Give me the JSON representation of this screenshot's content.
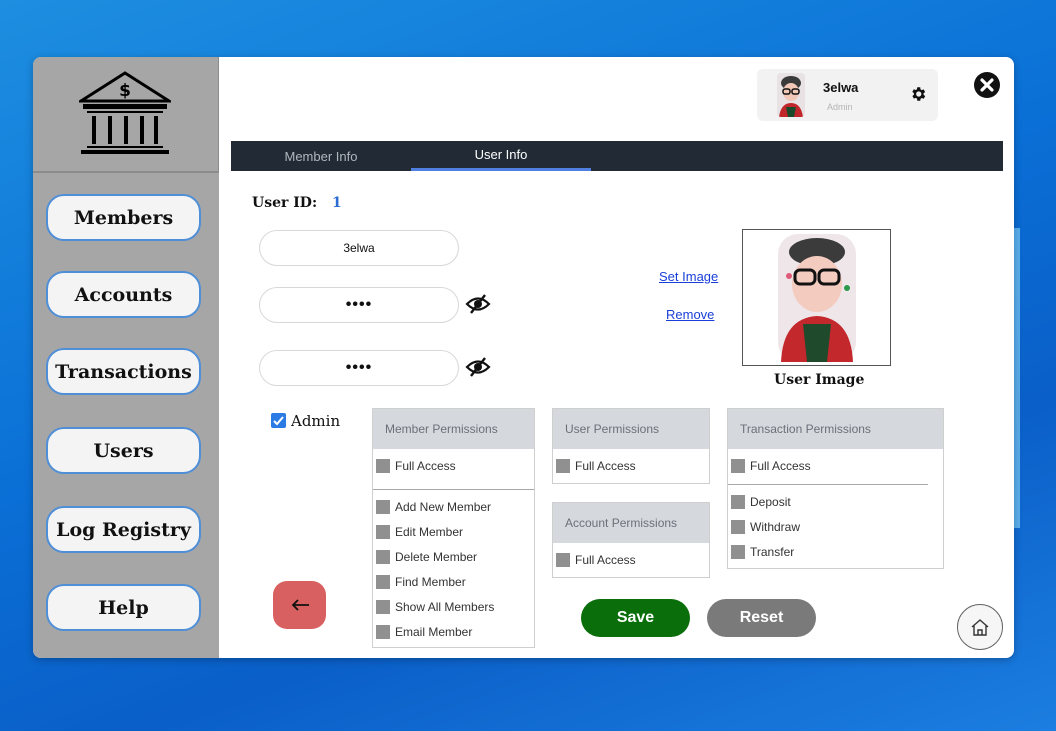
{
  "sidebar": {
    "items": [
      {
        "label": "Members"
      },
      {
        "label": "Accounts"
      },
      {
        "label": "Transactions"
      },
      {
        "label": "Users"
      },
      {
        "label": "Log Registry"
      },
      {
        "label": "Help"
      }
    ]
  },
  "user_card": {
    "name": "3elwa",
    "role": "Admin"
  },
  "tabs": [
    {
      "label": "Member Info",
      "active": false
    },
    {
      "label": "User Info",
      "active": true
    }
  ],
  "form": {
    "user_id_label": "User ID:",
    "user_id_value": "1",
    "username_value": "3elwa",
    "password_value": "••••",
    "confirm_password_value": "••••",
    "admin_label": "Admin",
    "admin_checked": true
  },
  "image": {
    "set_label": "Set Image",
    "remove_label": "Remove",
    "caption": "User Image"
  },
  "permissions": {
    "member": {
      "title": "Member Permissions",
      "full_access": "Full Access",
      "items": [
        "Add New Member",
        "Edit Member",
        "Delete Member",
        "Find Member",
        "Show All Members",
        "Email Member"
      ]
    },
    "user": {
      "title": "User Permissions",
      "full_access": "Full Access"
    },
    "account": {
      "title": "Account Permissions",
      "full_access": "Full Access"
    },
    "transaction": {
      "title": "Transaction Permissions",
      "full_access": "Full Access",
      "items": [
        "Deposit",
        "Withdraw",
        "Transfer"
      ]
    }
  },
  "actions": {
    "save_label": "Save",
    "reset_label": "Reset"
  },
  "colors": {
    "sidebar": "#a6a6a6",
    "tabbar": "#222a35",
    "tab_accent": "#4f7fe0",
    "save": "#0a6e0a",
    "reset": "#7a7a7a",
    "back": "#d96060",
    "checkbox": "#2c7be5"
  },
  "icons": {
    "logo": "bank-icon",
    "close": "close-circle-icon",
    "settings": "gear-icon",
    "eye": "eye-slash-icon",
    "back": "arrow-left-icon",
    "home": "home-icon"
  }
}
